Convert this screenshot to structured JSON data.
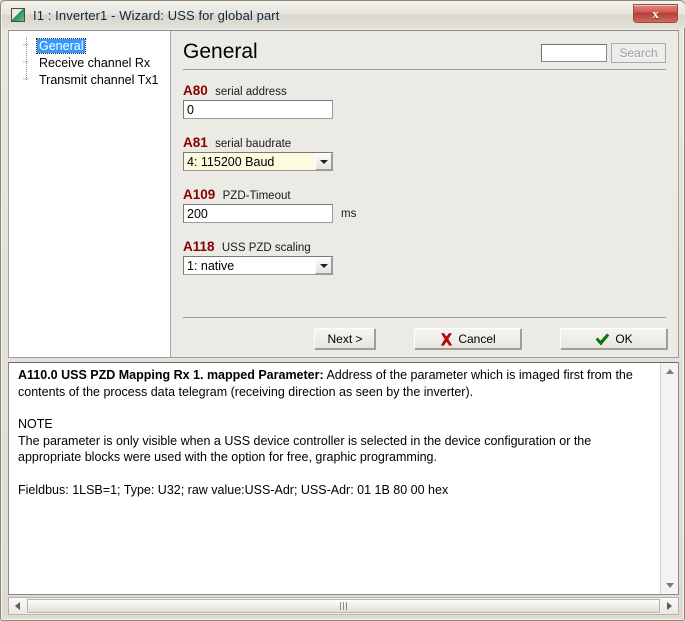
{
  "window": {
    "title": "I1 : Inverter1 - Wizard: USS for global part",
    "icon": "application-icon",
    "close_label": "x"
  },
  "tree": {
    "items": [
      {
        "label": "General",
        "selected": true
      },
      {
        "label": "Receive channel Rx",
        "selected": false
      },
      {
        "label": "Transmit channel Tx1",
        "selected": false
      }
    ]
  },
  "content": {
    "title": "General",
    "search": {
      "value": "",
      "placeholder": "",
      "button_label": "Search",
      "button_disabled": true
    },
    "parameters": [
      {
        "code": "A80",
        "description": "serial address",
        "control": "text",
        "value": "0",
        "unit": "",
        "modified": false
      },
      {
        "code": "A81",
        "description": "serial baudrate",
        "control": "combo",
        "value": "4: 115200 Baud",
        "unit": "",
        "modified": true
      },
      {
        "code": "A109",
        "description": "PZD-Timeout",
        "control": "text",
        "value": "200",
        "unit": "ms",
        "modified": false
      },
      {
        "code": "A118",
        "description": "USS PZD scaling",
        "control": "combo",
        "value": "1: native",
        "unit": "",
        "modified": false
      }
    ],
    "buttons": {
      "next": "Next >",
      "cancel": "Cancel",
      "ok": "OK"
    }
  },
  "description": {
    "heading": "A110.0  USS PZD Mapping Rx 1. mapped Parameter:",
    "intro": " Address of the parameter which is imaged first from the contents of the process data telegram (receiving direction as seen by the inverter).",
    "note_title": "NOTE",
    "note_body": "The parameter is only visible when a USS device controller is selected in the device configuration or the appropriate blocks were used with the option for free, graphic programming.",
    "fieldbus": "Fieldbus: 1LSB=1; Type: U32; raw value:USS-Adr; USS-Adr: 01 1B 80 00 hex"
  },
  "colors": {
    "param_code": "#8b0000",
    "selection": "#3399ff",
    "modified_field": "#fdfbdf",
    "close_button": "#b83b33",
    "cancel_icon": "#cc0000",
    "ok_icon": "#008000"
  }
}
